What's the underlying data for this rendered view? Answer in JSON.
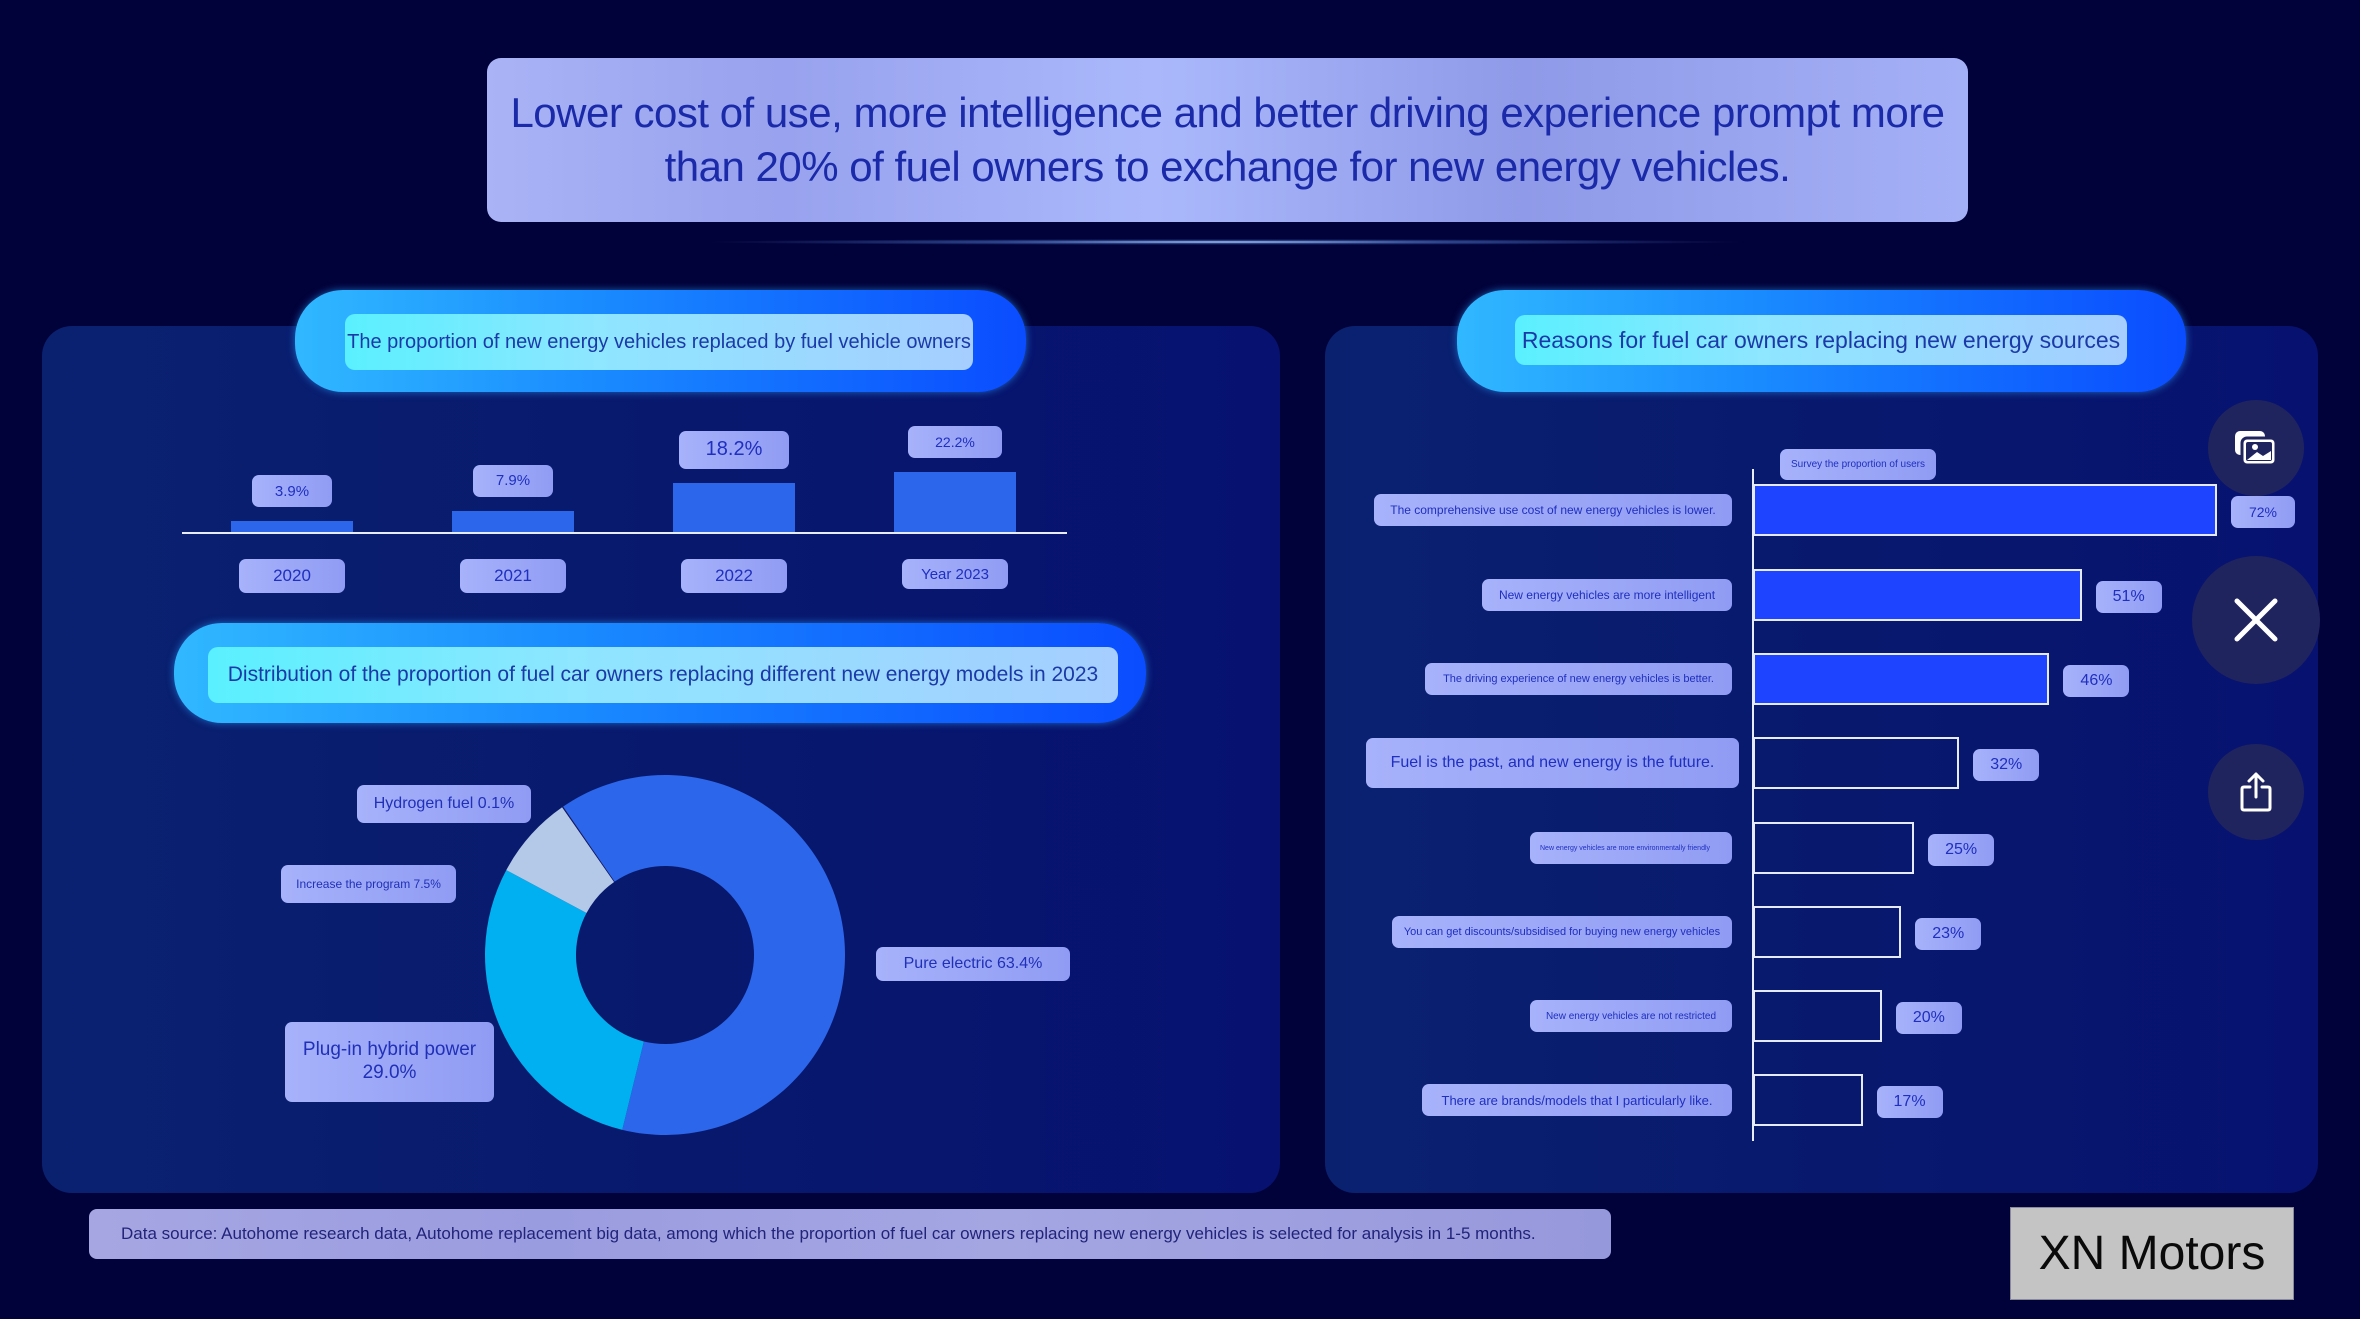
{
  "headline": "Lower cost of use, more intelligence and better driving experience prompt more than 20% of fuel owners to exchange for new energy vehicles.",
  "colors": {
    "background": "#02023a",
    "bar_fill": "#2c66ea",
    "donut_electric": "#2c66ea",
    "donut_hybrid": "#00b0f0",
    "donut_program": "#b4c8e8",
    "donut_hydrogen": "#1a1a60",
    "reason_bar_fill": "#1f44ff",
    "tag_text": "#1f2fbf"
  },
  "left_panel": {
    "bar_section_title": "The proportion of new energy vehicles replaced by fuel vehicle owners",
    "donut_section_title": "Distribution of the proportion of fuel car owners replacing different new energy models in 2023"
  },
  "right_panel": {
    "section_title": "Reasons for fuel car owners replacing new energy sources",
    "series_label": "Survey the proportion of users"
  },
  "side_buttons": [
    {
      "name": "gallery",
      "icon": "photos-icon"
    },
    {
      "name": "close",
      "icon": "close-icon"
    },
    {
      "name": "share",
      "icon": "share-icon"
    }
  ],
  "footer_note": "Data source: Autohome research data, Autohome replacement big data, among which the proportion of fuel car owners replacing new energy vehicles is selected for analysis in 1-5 months.",
  "brand": "XN Motors",
  "chart_data": [
    {
      "type": "bar",
      "title": "The proportion of new energy vehicles replaced by fuel vehicle owners",
      "categories": [
        "2020",
        "2021",
        "2022",
        "Year 2023"
      ],
      "values": [
        3.9,
        7.9,
        18.2,
        22.2
      ],
      "value_labels": [
        "3.9%",
        "7.9%",
        "18.2%",
        "22.2%"
      ],
      "unit": "%",
      "xlabel": "",
      "ylabel": "",
      "ylim": [
        0,
        25
      ],
      "grid": false
    },
    {
      "type": "pie",
      "donut": true,
      "title": "Distribution of the proportion of fuel car owners replacing different new energy models in 2023",
      "categories": [
        "Pure electric",
        "Plug-in hybrid power",
        "Increase the program",
        "Hydrogen fuel"
      ],
      "values": [
        63.4,
        29.0,
        7.5,
        0.1
      ],
      "labels": [
        "Pure electric 63.4%",
        "Plug-in hybrid power 29.0%",
        "Increase the program 7.5%",
        "Hydrogen fuel 0.1%"
      ]
    },
    {
      "type": "bar",
      "orientation": "horizontal",
      "title": "Reasons for fuel car owners replacing new energy sources",
      "legend": [
        "Survey the proportion of users"
      ],
      "categories": [
        "The comprehensive use cost of new energy vehicles is lower.",
        "New energy vehicles are more intelligent",
        "The driving experience of new energy vehicles is better.",
        "Fuel is the past, and new energy is the future.",
        "New energy vehicles are more environmentally friendly",
        "You can get discounts/subsidised for buying new energy vehicles",
        "New energy vehicles are not restricted",
        "There are brands/models that I particularly like."
      ],
      "values": [
        72,
        51,
        46,
        32,
        25,
        23,
        20,
        17
      ],
      "value_labels": [
        "72%",
        "51%",
        "46%",
        "32%",
        "25%",
        "23%",
        "20%",
        "17%"
      ],
      "filled": [
        true,
        true,
        true,
        false,
        false,
        false,
        false,
        false
      ],
      "unit": "%",
      "xlim": [
        0,
        72
      ],
      "grid": false
    }
  ]
}
